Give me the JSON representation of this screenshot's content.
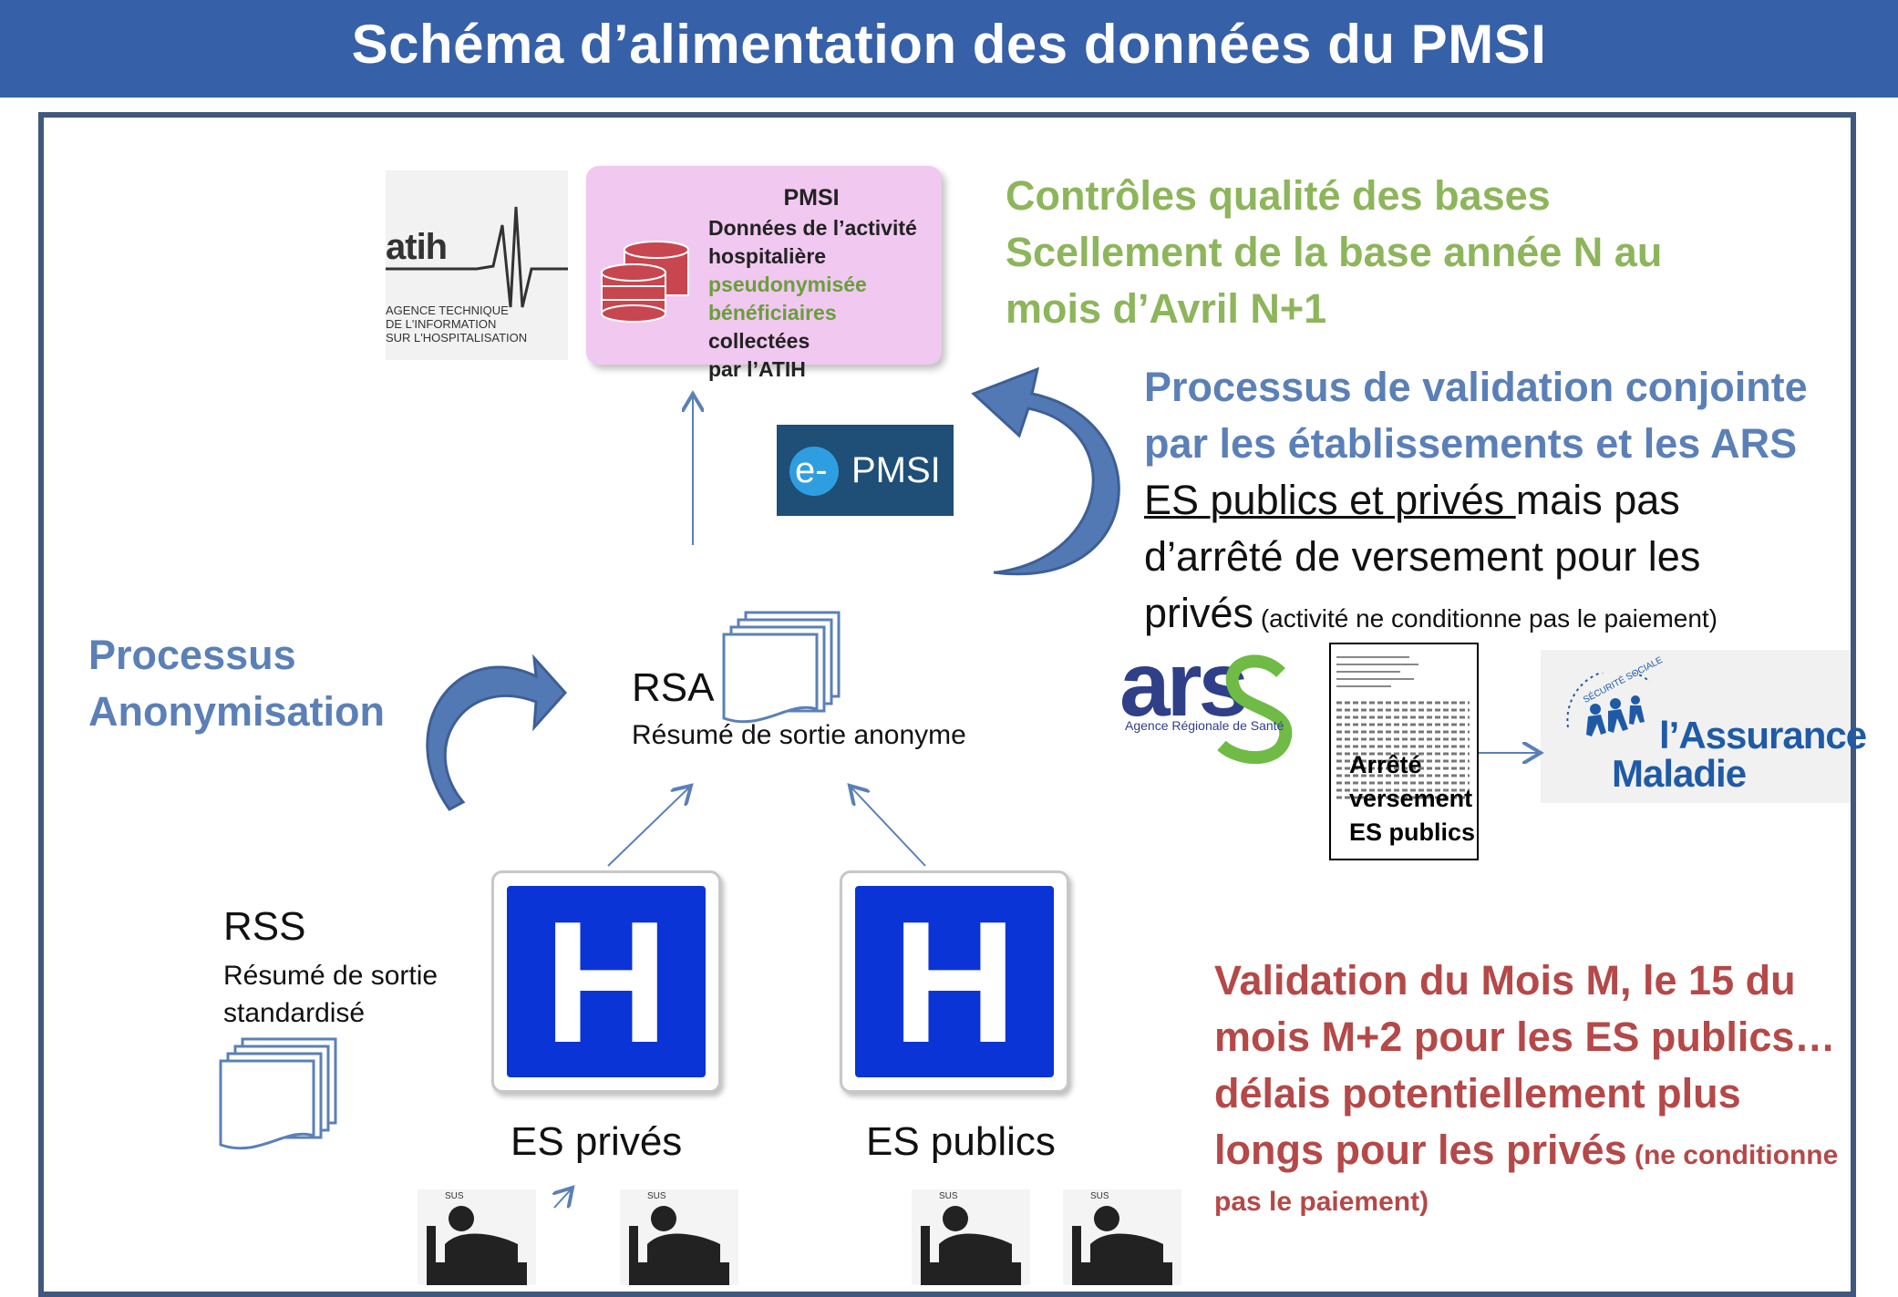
{
  "header": {
    "title": "Schéma d’alimentation des données du PMSI"
  },
  "atih_logo": {
    "name": "atih",
    "subtitle_lines": [
      "AGENCE TECHNIQUE",
      "DE L'INFORMATION",
      "SUR L'HOSPITALISATION"
    ]
  },
  "pmsi_box": {
    "heading": "PMSI",
    "line1": "Données de l’activité",
    "line2": "hospitalière",
    "line3_green": "pseudonymisée",
    "line4_green": "bénéficiaires",
    "line4_rest": " collectées",
    "line5": "par l’ATIH"
  },
  "controls": {
    "line1": "Contrôles qualité des bases",
    "line2": "Scellement de la base année N au",
    "line3": "mois d’Avril  N+1"
  },
  "epmsi": {
    "prefix": "e-",
    "label": "PMSI"
  },
  "validation": {
    "line1": "Processus de validation conjointe",
    "line2": "par les établissements et les ARS",
    "underlined": "ES publics et privés ",
    "line3_rest": "mais pas",
    "line4": "d’arrêté de versement pour les",
    "line5": "privés",
    "line5_note": " (activité ne conditionne pas le paiement)"
  },
  "anonymisation": {
    "line1": "Processus",
    "line2": "Anonymisation"
  },
  "rsa": {
    "title": "RSA",
    "subtitle": "Résumé de sortie anonyme"
  },
  "rss": {
    "title": "RSS",
    "line1": "Résumé de sortie",
    "line2": "standardisé"
  },
  "hospitals": [
    {
      "letter": "H",
      "label": "ES privés"
    },
    {
      "letter": "H",
      "label": "ES publics"
    }
  ],
  "ars_logo": {
    "name": "ars",
    "subtitle": "Agence Régionale de Santé"
  },
  "arrete": {
    "line1": "Arrêté",
    "line2": "versement",
    "line3": "ES publics"
  },
  "assurance_maladie": {
    "line1": "l’Assurance",
    "line2": "Maladie",
    "arc": "SÉCURITÉ SOCIALE"
  },
  "validation_mois": {
    "line1": "Validation du Mois M, le 15 du",
    "line2": "mois M+2 pour les ES publics…",
    "line3": "délais potentiellement  plus",
    "line4": "longs pour les privés",
    "note_a": " (ne conditionne",
    "note_b": "pas le paiement)"
  },
  "patient_icon_label": "SUS",
  "colors": {
    "header": "#3660a8",
    "frame": "#40587e",
    "green_text": "#8db55b",
    "blue_text": "#5b80b7",
    "red_text": "#b54848",
    "hospital_sign": "#0b34d6",
    "pmsi_box": "#f0c8f0",
    "epmsi": "#1f4e77"
  }
}
